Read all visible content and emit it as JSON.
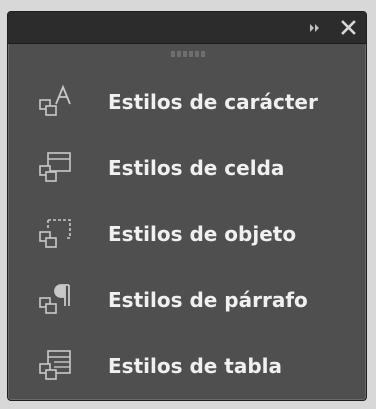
{
  "panel": {
    "items": [
      {
        "label": "Estilos de carácter",
        "icon": "character-styles-icon"
      },
      {
        "label": "Estilos de celda",
        "icon": "cell-styles-icon"
      },
      {
        "label": "Estilos de objeto",
        "icon": "object-styles-icon"
      },
      {
        "label": "Estilos de párrafo",
        "icon": "paragraph-styles-icon"
      },
      {
        "label": "Estilos de tabla",
        "icon": "table-styles-icon"
      }
    ]
  },
  "titlebar": {
    "collapse_icon": "double-chevron-right-icon",
    "close_icon": "close-icon"
  },
  "colors": {
    "panel_bg": "#4f4f4f",
    "titlebar_bg": "#2c2c2c",
    "text": "#f0f0f0",
    "icon": "#c8c8c8"
  }
}
